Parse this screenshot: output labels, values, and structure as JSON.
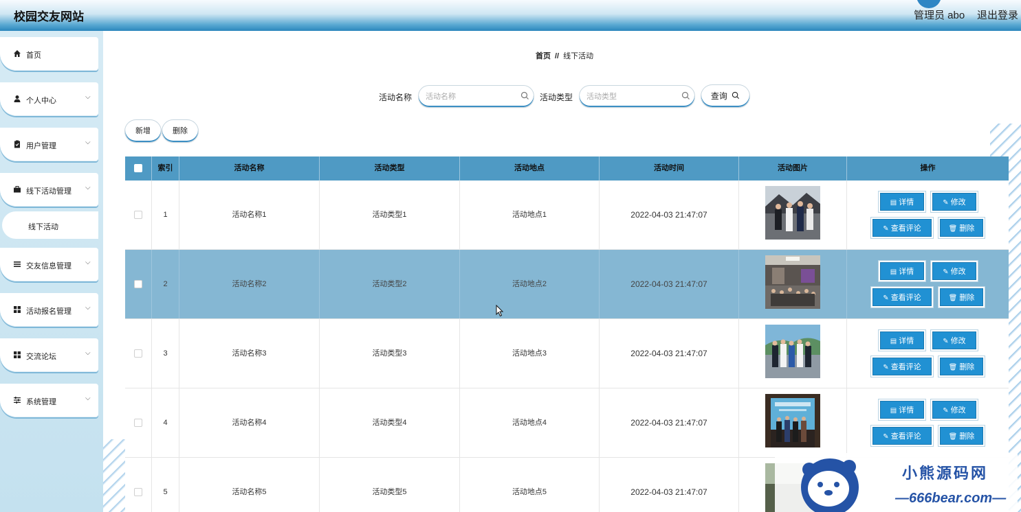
{
  "header": {
    "title": "校园交友网站",
    "admin": "管理员 abo",
    "logout": "退出登录"
  },
  "sidebar": {
    "items": [
      {
        "label": "首页",
        "icon": "home-icon"
      },
      {
        "label": "个人中心",
        "icon": "user-icon"
      },
      {
        "label": "用户管理",
        "icon": "clipboard-icon"
      },
      {
        "label": "线下活动管理",
        "icon": "briefcase-icon"
      },
      {
        "label": "线下活动",
        "icon": ""
      },
      {
        "label": "交友信息管理",
        "icon": "list-icon"
      },
      {
        "label": "活动报名管理",
        "icon": "grid-icon"
      },
      {
        "label": "交流论坛",
        "icon": "grid-icon"
      },
      {
        "label": "系统管理",
        "icon": "sliders-icon"
      }
    ]
  },
  "breadcrumb": {
    "home": "首页",
    "sep": "//",
    "current": "线下活动"
  },
  "search": {
    "name_label": "活动名称",
    "name_placeholder": "活动名称",
    "type_label": "活动类型",
    "type_placeholder": "活动类型",
    "query_label": "查询"
  },
  "toolbar": {
    "add_label": "新增",
    "delete_label": "删除"
  },
  "table": {
    "headers": [
      "索引",
      "活动名称",
      "活动类型",
      "活动地点",
      "活动时间",
      "活动图片",
      "操作"
    ],
    "rows": [
      {
        "index": "1",
        "name": "活动名称1",
        "type": "活动类型1",
        "place": "活动地点1",
        "time": "2022-04-03 21:47:07"
      },
      {
        "index": "2",
        "name": "活动名称2",
        "type": "活动类型2",
        "place": "活动地点2",
        "time": "2022-04-03 21:47:07"
      },
      {
        "index": "3",
        "name": "活动名称3",
        "type": "活动类型3",
        "place": "活动地点3",
        "time": "2022-04-03 21:47:07"
      },
      {
        "index": "4",
        "name": "活动名称4",
        "type": "活动类型4",
        "place": "活动地点4",
        "time": "2022-04-03 21:47:07"
      },
      {
        "index": "5",
        "name": "活动名称5",
        "type": "活动类型5",
        "place": "活动地点5",
        "time": "2022-04-03 21:47:07"
      }
    ],
    "actions": {
      "detail": "详情",
      "edit": "修改",
      "comments": "查看评论",
      "delete": "删除"
    }
  },
  "watermark": {
    "title": "小熊源码网",
    "subtitle": "—666bear.com—"
  },
  "colors": {
    "accent": "#2191d3",
    "header_blue": "#2b86bd",
    "table_head": "#4f9ac4",
    "row_highlight": "#85b7d3"
  }
}
